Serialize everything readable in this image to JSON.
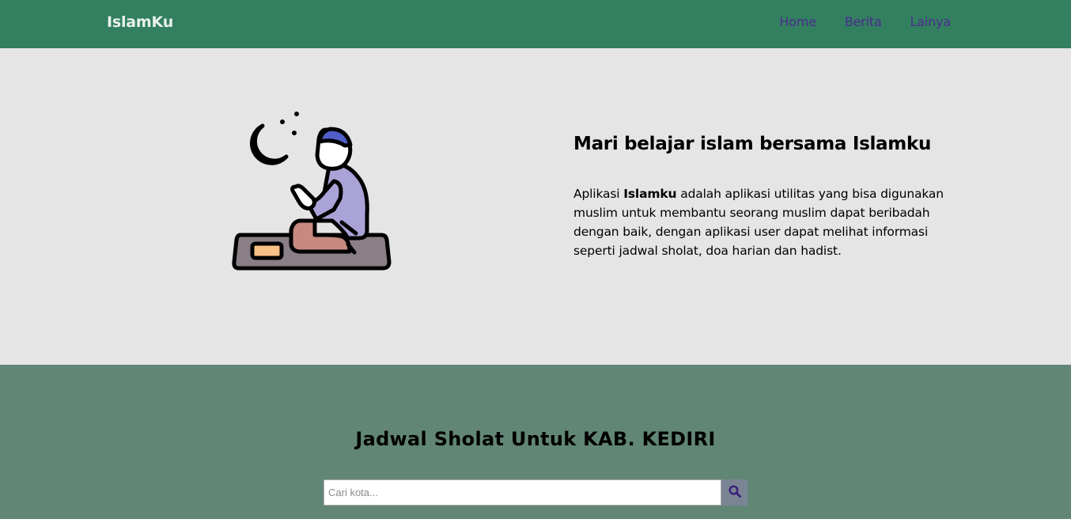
{
  "navbar": {
    "brand": "IslamKu",
    "links": [
      {
        "label": "Home"
      },
      {
        "label": "Berita"
      },
      {
        "label": "Lainya"
      }
    ]
  },
  "hero": {
    "title": "Mari belajar islam bersama Islamku",
    "desc_prefix": "Aplikasi ",
    "desc_bold": "Islamku",
    "desc_suffix": " adalah aplikasi utilitas yang bisa digunakan muslim untuk membantu seorang muslim dapat beribadah dengan baik, dengan aplikasi user dapat melihat informasi seperti jadwal sholat, doa harian dan hadist.",
    "illustration_icon": "praying-man-icon"
  },
  "schedule": {
    "title": "Jadwal Sholat Untuk KAB. KEDIRI",
    "search": {
      "placeholder": "Cari kota...",
      "value": "",
      "button_icon": "search-icon"
    }
  },
  "colors": {
    "navbar_bg": "#338061",
    "nav_link": "#4a2b8e",
    "hero_bg": "#e5e5e5",
    "schedule_bg": "#628676",
    "search_button_bg": "#7b8495"
  }
}
